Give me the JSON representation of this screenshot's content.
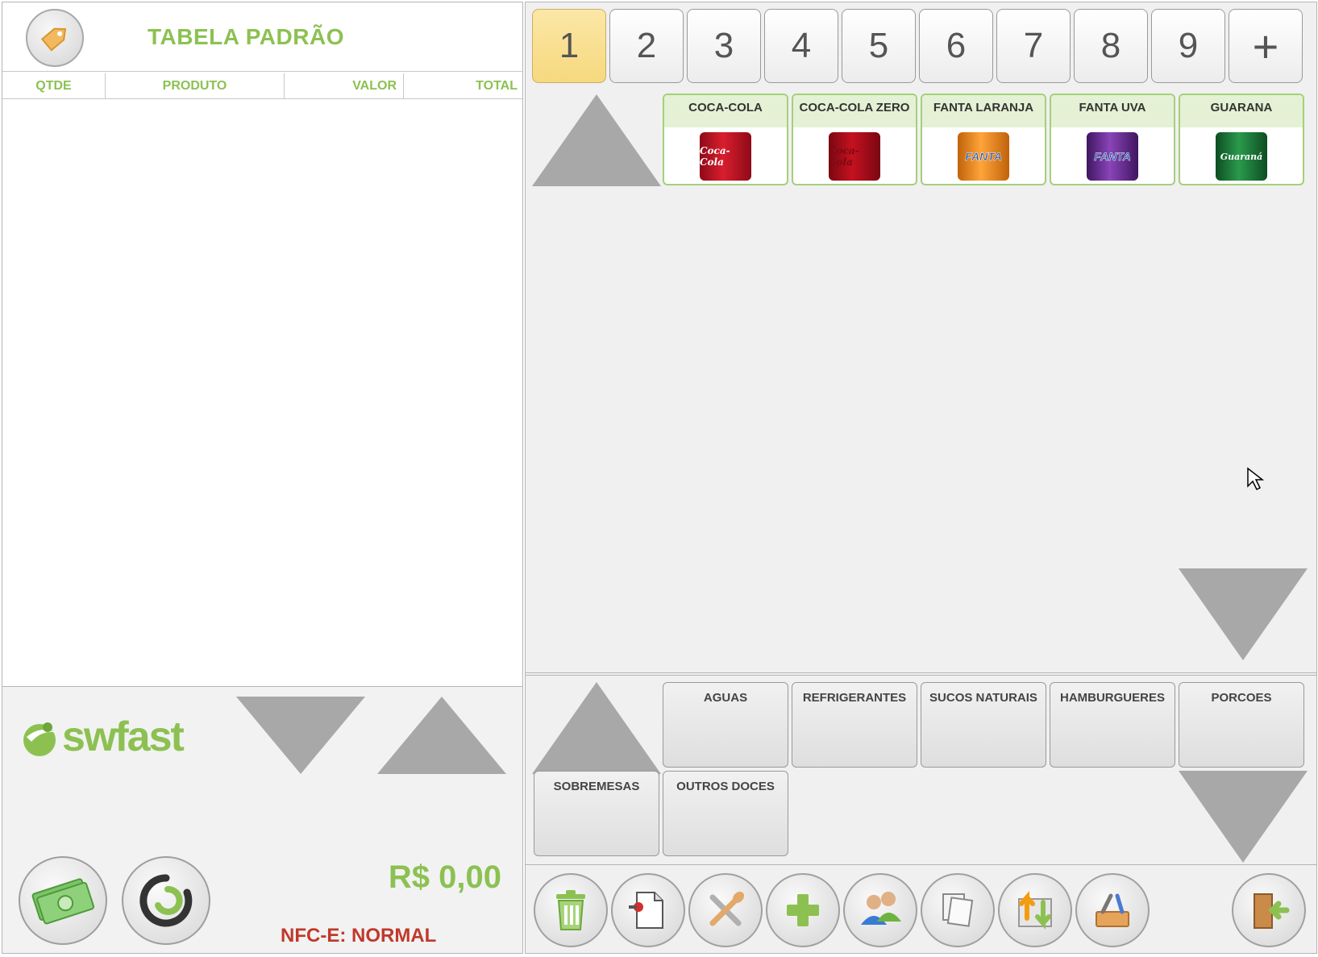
{
  "order": {
    "price_table_title": "TABELA PADRÃO",
    "columns": {
      "qty": "QTDE",
      "product": "PRODUTO",
      "value": "VALOR",
      "total": "TOTAL"
    },
    "total_amount": "R$ 0,00",
    "nfce_status": "NFC-E: NORMAL"
  },
  "brand": {
    "logo_text": "swfast"
  },
  "pages": [
    "1",
    "2",
    "3",
    "4",
    "5",
    "6",
    "7",
    "8",
    "9",
    "+"
  ],
  "active_page": "1",
  "products": [
    {
      "name": "COCA-COLA",
      "can_label": "Coca-Cola",
      "color": "#c8102e"
    },
    {
      "name": "COCA-COLA ZERO",
      "can_label": "Coca-Cola",
      "color": "#b20d1c"
    },
    {
      "name": "FANTA LARANJA",
      "can_label": "FANTA",
      "color": "#f28c1c"
    },
    {
      "name": "FANTA UVA",
      "can_label": "FANTA",
      "color": "#6a2c8e"
    },
    {
      "name": "GUARANA",
      "can_label": "Guaraná",
      "color": "#1b7a3a"
    }
  ],
  "categories": [
    {
      "label": "AGUAS"
    },
    {
      "label": "REFRIGERANTES"
    },
    {
      "label": "SUCOS NATURAIS"
    },
    {
      "label": "HAMBURGUERES"
    },
    {
      "label": "PORCOES"
    },
    {
      "label": "SOBREMESAS"
    },
    {
      "label": "OUTROS DOCES"
    }
  ],
  "toolbar_icons": [
    "trash-icon",
    "pin-document-icon",
    "cutlery-icon",
    "plus-icon",
    "users-icon",
    "documents-icon",
    "transfer-icon",
    "tools-icon",
    "exit-door-icon"
  ],
  "colors": {
    "accent_green": "#8cc152",
    "active_page": "#f6d87e",
    "nfce_red": "#c0392b"
  }
}
